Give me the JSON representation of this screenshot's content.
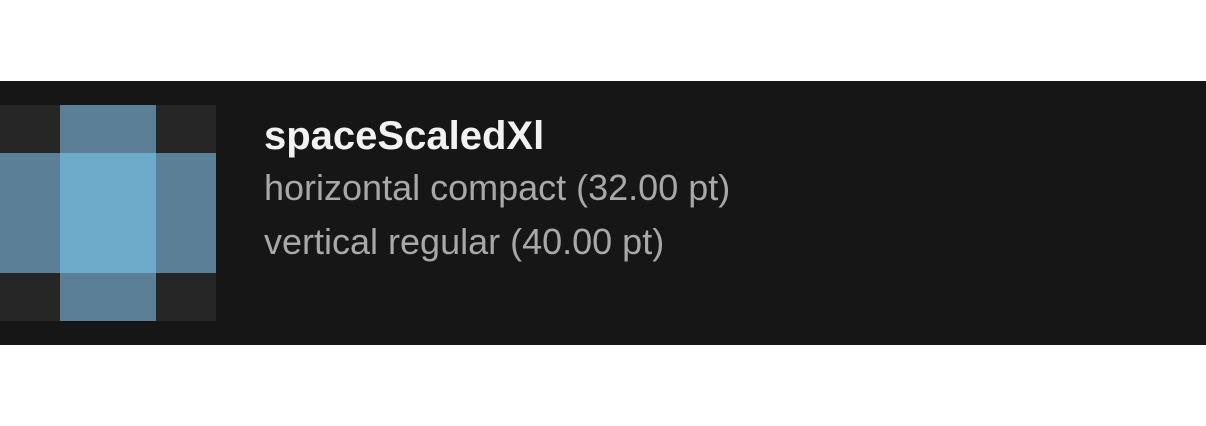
{
  "token": {
    "name": "spaceScaledXl",
    "horizontal": "horizontal compact (32.00 pt)",
    "vertical": "vertical regular (40.00 pt)"
  },
  "colors": {
    "panel_background": "#161616",
    "swatch_corner": "#262626",
    "swatch_edge": "#5a7f96",
    "swatch_center": "#6eaaca",
    "name_text": "#f2f2f2",
    "detail_text": "#a8a8a8"
  }
}
